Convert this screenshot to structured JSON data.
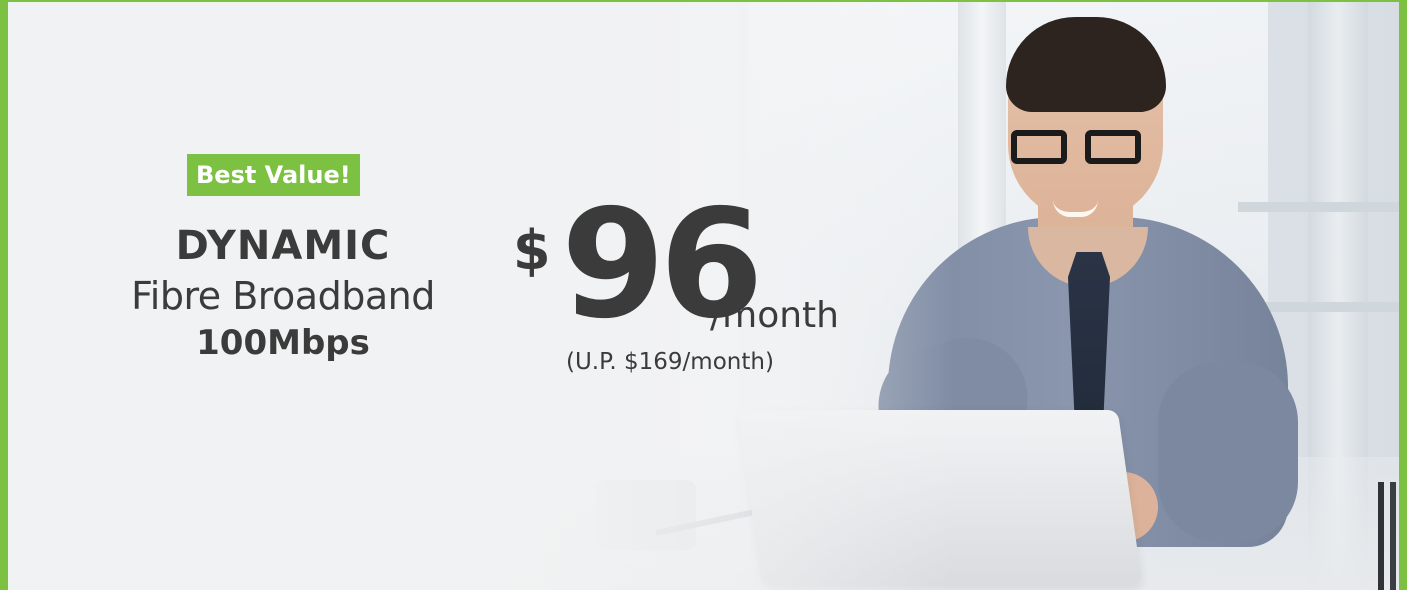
{
  "offer": {
    "badge": "Best Value!",
    "plan_name": "DYNAMIC",
    "plan_type": "Fibre Broadband",
    "speed": "100Mbps",
    "currency": "$",
    "price": "96",
    "period": "/month",
    "usual_price": "(U.P. $169/month)"
  },
  "colors": {
    "accent": "#7cc142",
    "text": "#3b3b3b"
  },
  "icons": {
    "background": "person-with-laptop-photo"
  }
}
